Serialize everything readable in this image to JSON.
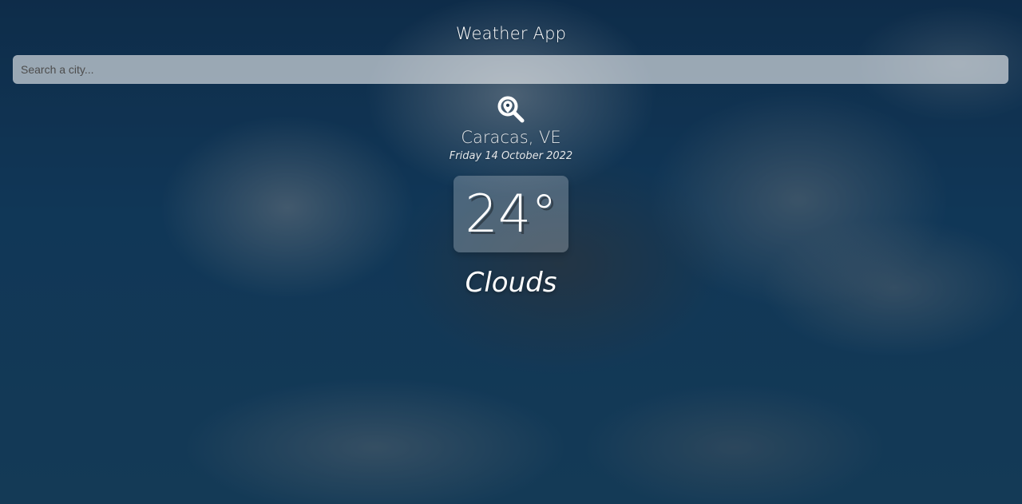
{
  "app": {
    "title": "Weather App"
  },
  "search": {
    "placeholder": "Search a city...",
    "value": ""
  },
  "weather": {
    "location": "Caracas, VE",
    "date": "Friday 14 October 2022",
    "temperature": "24°",
    "condition": "Clouds"
  },
  "icons": {
    "search": "search-location-icon"
  },
  "colors": {
    "text": "#ffffff",
    "searchBg": "rgba(255,255,255,0.58)",
    "cardBg": "rgba(255,255,255,0.24)"
  }
}
